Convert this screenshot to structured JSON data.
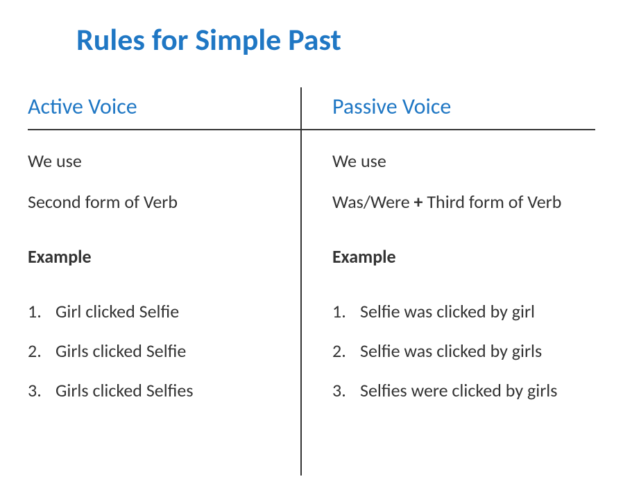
{
  "title": "Rules for Simple Past",
  "columns": {
    "active": {
      "header": "Active Voice",
      "weUse": "We use",
      "rule": "Second form of Verb",
      "exampleLabel": "Example",
      "examples": [
        "Girl clicked Selfie",
        "Girls clicked Selfie",
        "Girls clicked Selfies"
      ]
    },
    "passive": {
      "header": "Passive Voice",
      "weUse": "We use",
      "rulePrefix": "Was/Were ",
      "rulePlus": "+",
      "ruleSuffix": " Third form of Verb",
      "exampleLabel": "Example",
      "examples": [
        "Selfie was clicked by girl",
        "Selfie was clicked by girls",
        "Selfies were clicked by girls"
      ]
    }
  }
}
